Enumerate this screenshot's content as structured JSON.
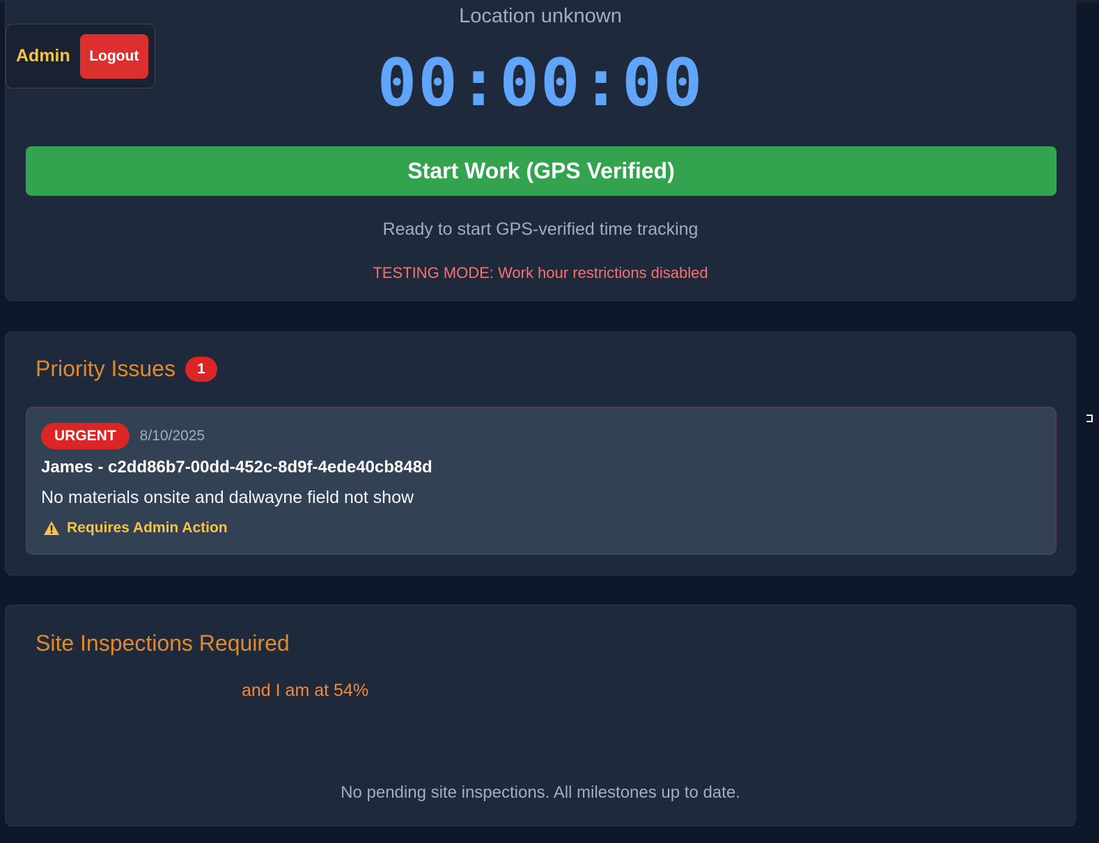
{
  "timer": {
    "location": "Location unknown",
    "display": "00:00:00",
    "start_button_label": "Start Work (GPS Verified)",
    "status": "Ready to start GPS-verified time tracking",
    "testing_notice": "TESTING MODE: Work hour restrictions disabled"
  },
  "user": {
    "role": "Admin",
    "logout_label": "Logout"
  },
  "priority": {
    "title": "Priority Issues",
    "count": "1",
    "issues": [
      {
        "priority": "URGENT",
        "date": "8/10/2025",
        "title": "James - c2dd86b7-00dd-452c-8d9f-4ede40cb848d",
        "description": "No materials onsite and dalwayne field not show",
        "action": "Requires Admin Action",
        "action_icon": "warning-icon"
      }
    ]
  },
  "inspections": {
    "title": "Site Inspections Required",
    "progress_text": "and I am at 54%",
    "empty_message": "No pending site inspections. All milestones up to date."
  },
  "colors": {
    "background": "#0f172a",
    "card": "#1e293b",
    "timer": "#60a5fa",
    "start_button": "#34a350",
    "danger": "#dc2626",
    "admin_accent": "#f6c344",
    "section_title": "#e08a2c"
  }
}
